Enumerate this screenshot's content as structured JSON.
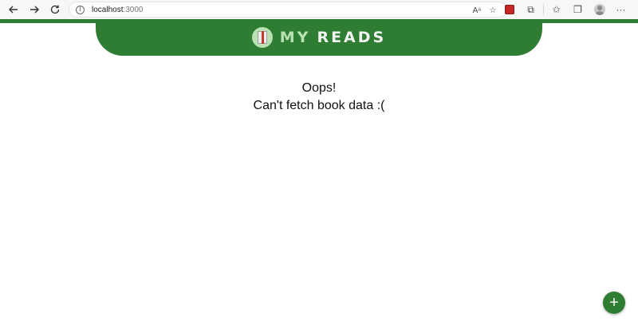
{
  "browser": {
    "url_host": "localhost",
    "url_port": ":3000"
  },
  "header": {
    "title_part1": "MY",
    "title_part2": "READS",
    "brand_color": "#2e7d32",
    "accent_color": "#b9e2b4"
  },
  "main": {
    "line1": "Oops!",
    "line2": "Can't fetch book data :("
  },
  "fab": {
    "icon": "plus-icon",
    "label": "+"
  }
}
